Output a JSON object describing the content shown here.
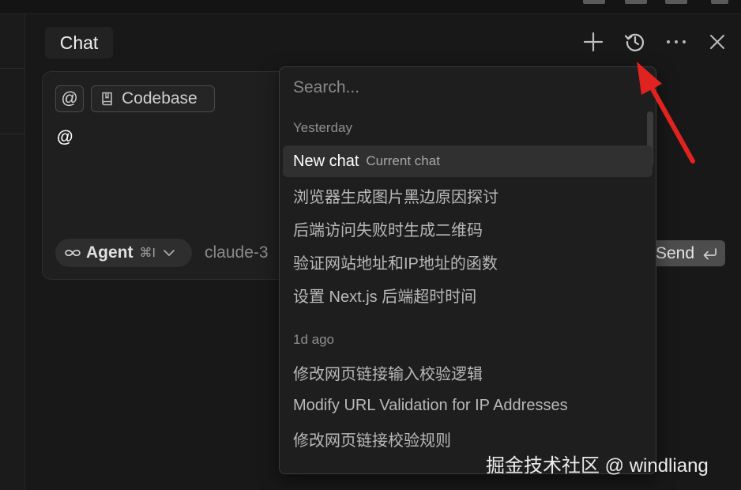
{
  "header": {
    "title": "Chat",
    "new_chat_icon": "plus-icon",
    "history_icon": "history-icon",
    "more_icon": "ellipsis-icon",
    "close_icon": "close-icon"
  },
  "composer": {
    "at_chip": "@",
    "codebase_chip": "Codebase",
    "input_text": "@",
    "mode_label": "Agent",
    "mode_shortcut": "⌘I",
    "model_label": "claude-3",
    "send_label": "Send"
  },
  "history": {
    "search_placeholder": "Search...",
    "groups": [
      {
        "label": "Yesterday",
        "items": [
          {
            "title": "New chat",
            "badge": "Current chat"
          },
          {
            "title": "浏览器生成图片黑边原因探讨"
          },
          {
            "title": "后端访问失败时生成二维码"
          },
          {
            "title": "验证网站地址和IP地址的函数"
          },
          {
            "title": "设置 Next.js 后端超时时间"
          }
        ]
      },
      {
        "label": "1d ago",
        "items": [
          {
            "title": "修改网页链接输入校验逻辑"
          },
          {
            "title": "Modify URL Validation for IP Addresses"
          },
          {
            "title": "修改网页链接校验规则"
          }
        ]
      }
    ]
  },
  "watermark": "掘金技术社区 @ windliang",
  "colors": {
    "background": "#181818",
    "panel": "#1e1e1e",
    "active_item": "#303030",
    "annotation_arrow": "#e0231f"
  }
}
